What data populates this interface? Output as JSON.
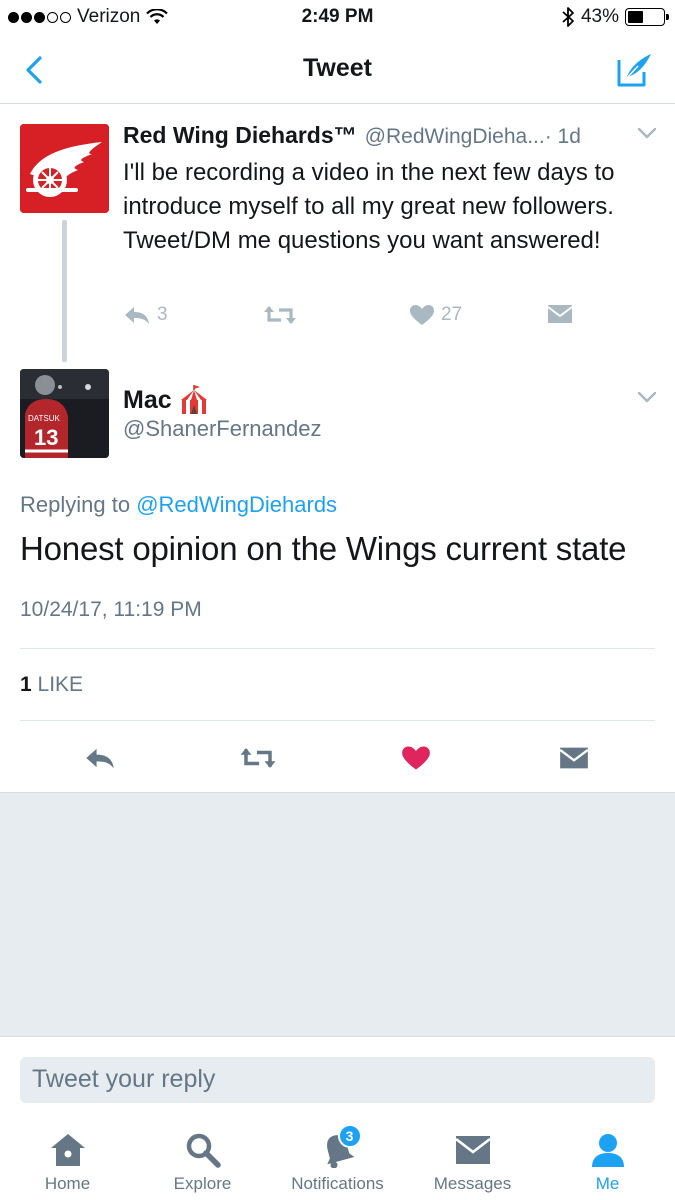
{
  "status_bar": {
    "carrier": "Verizon",
    "time": "2:49 PM",
    "battery_percent": "43%",
    "battery_level": 0.43,
    "signal_bars": 3
  },
  "nav": {
    "title": "Tweet",
    "back_icon": "chevron-left-icon",
    "compose_icon": "compose-icon",
    "accent": "#1da1f2"
  },
  "parent_tweet": {
    "name": "Red Wing Diehards™",
    "handle": "@RedWingDieha...",
    "time": "· 1d",
    "text": "I'll be recording a video in the next few days to introduce myself to all my great new followers. Tweet/DM me questions you want answered!",
    "reply_count": "3",
    "like_count": "27"
  },
  "reply_tweet": {
    "name": "Mac",
    "name_emoji": "circus-tent-icon",
    "handle": "@ShanerFernandez",
    "replying_prefix": "Replying to",
    "replying_to": "@RedWingDiehards",
    "text": "Honest opinion on the Wings current state",
    "timestamp": "10/24/17, 11:19 PM",
    "likes_count": "1",
    "likes_label": "LIKE",
    "liked": true,
    "like_color": "#e0245e"
  },
  "composer": {
    "placeholder": "Tweet your reply"
  },
  "tabs": [
    {
      "label": "Home",
      "icon": "home-icon",
      "badge": null
    },
    {
      "label": "Explore",
      "icon": "search-icon",
      "badge": null
    },
    {
      "label": "Notifications",
      "icon": "bell-icon",
      "badge": "3"
    },
    {
      "label": "Messages",
      "icon": "envelope-icon",
      "badge": null
    },
    {
      "label": "Me",
      "icon": "person-icon",
      "badge": null,
      "active": true
    }
  ]
}
